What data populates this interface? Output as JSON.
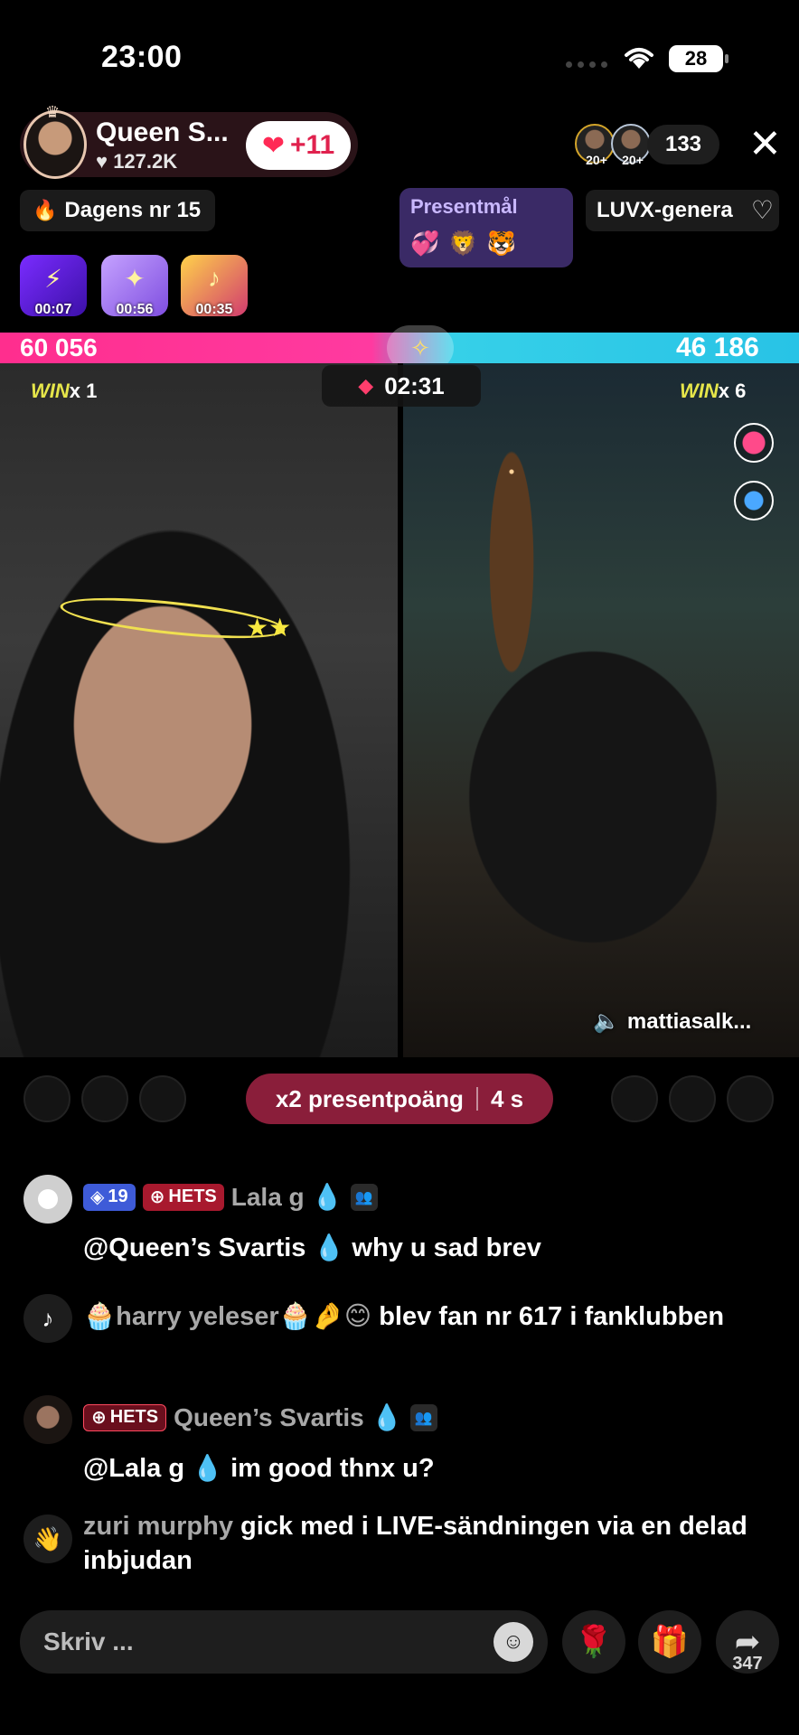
{
  "status_bar": {
    "time": "23:00",
    "battery": "28"
  },
  "host": {
    "name": "Queen S...",
    "likes": "127.2K",
    "follow_label": "+11"
  },
  "viewers": {
    "badge_1": "20+",
    "badge_2": "20+",
    "count": "133"
  },
  "chips": {
    "dagens": "Dagens nr 15",
    "gift_goal_title": "Presentmål",
    "luvx": "LUVX-genera"
  },
  "boosters": [
    {
      "time": "00:07"
    },
    {
      "time": "00:56"
    },
    {
      "time": "00:35"
    }
  ],
  "battle": {
    "score_left": "60 056",
    "score_right": "46 186",
    "timer": "02:31",
    "win_left_label": "WIN",
    "win_left_count": "x 1",
    "win_right_label": "WIN",
    "win_right_count": "x 6",
    "opponent": "mattiasalk...",
    "multiplier_label": "x2 presentpoäng",
    "multiplier_time": "4 s",
    "left_ratio": 0.565
  },
  "chat": [
    {
      "badge_level": "19",
      "badge_hets": "HETS",
      "user": "Lala g",
      "message_mention": "@Queen’s Svartis",
      "message_text": "why u sad brev"
    },
    {
      "user_prefix": "🧁harry yeleser🧁🤌😊",
      "message_text": "blev fan nr 617 i fanklubben"
    },
    {
      "badge_hets": "HETS",
      "user": "Queen’s Svartis",
      "message_mention": "@Lala g",
      "message_text": "im good thnx u?"
    },
    {
      "user": "zuri murphy",
      "message_text": "gick med i LIVE-sändningen via en delad inbjudan"
    }
  ],
  "composer": {
    "placeholder": "Skriv ...",
    "share_count": "347"
  },
  "colors": {
    "accent_pink": "#ff2e8e",
    "accent_cyan": "#28c3e6",
    "hets_red": "#a8192e"
  }
}
